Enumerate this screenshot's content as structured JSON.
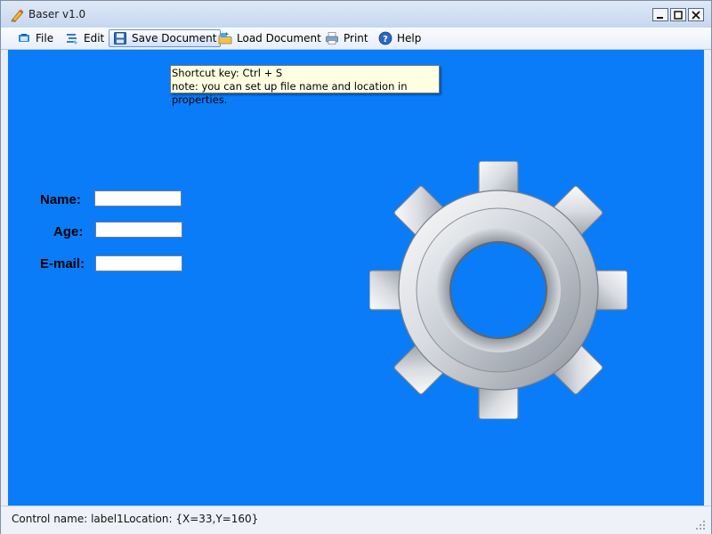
{
  "window": {
    "title": "Baser v1.0",
    "controls": {
      "minimize": "−",
      "maximize": "□",
      "close": "×"
    }
  },
  "menu": {
    "items": [
      {
        "label": "File",
        "icon": "file-icon"
      },
      {
        "label": "Edit",
        "icon": "edit-icon"
      },
      {
        "label": "Save Document",
        "icon": "save-icon",
        "active": true
      },
      {
        "label": "Load Document",
        "icon": "folder-icon"
      },
      {
        "label": "Print",
        "icon": "printer-icon"
      },
      {
        "label": "Help",
        "icon": "help-icon"
      }
    ]
  },
  "tooltip": {
    "line1": "Shortcut key: Ctrl + S",
    "line2": "note: you can set up file name and location in properties."
  },
  "form": {
    "name_label": "Name:",
    "age_label": "Age:",
    "email_label": "E-mail:",
    "name_value": "",
    "age_value": "",
    "email_value": ""
  },
  "status": {
    "text": "Control name: label1Location: {X=33,Y=160}"
  },
  "colors": {
    "canvas": "#0a7cf7",
    "tooltip": "#ffffe1"
  }
}
